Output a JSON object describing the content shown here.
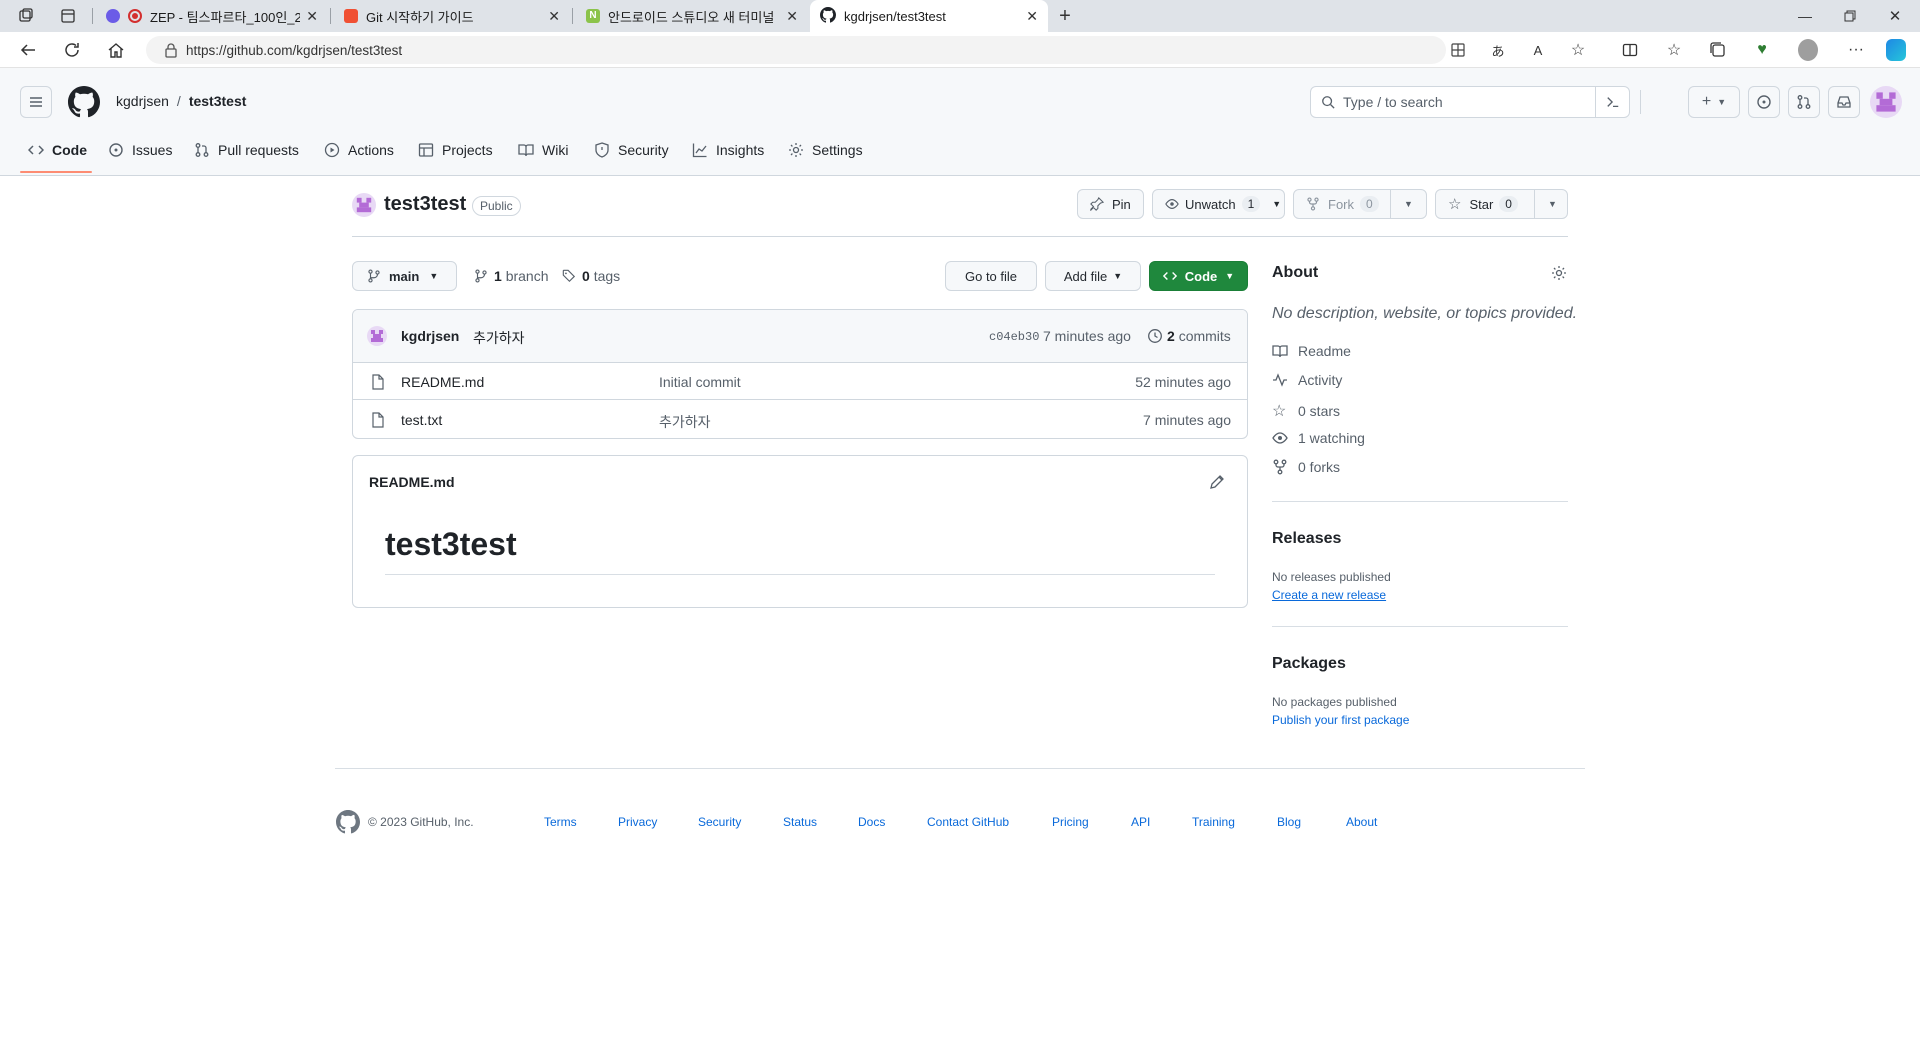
{
  "browser": {
    "tabs": [
      {
        "title": "ZEP - 팀스파르타_100인_2"
      },
      {
        "title": "Git 시작하기 가이드"
      },
      {
        "title": "안드로이드 스튜디오 새 터미널 열기"
      },
      {
        "title": "kgdrjsen/test3test"
      }
    ],
    "url": "https://github.com/kgdrjsen/test3test"
  },
  "header": {
    "owner": "kgdrjsen",
    "separator": "/",
    "repo": "test3test",
    "search_placeholder": "Type / to search"
  },
  "nav": {
    "items": [
      "Code",
      "Issues",
      "Pull requests",
      "Actions",
      "Projects",
      "Wiki",
      "Security",
      "Insights",
      "Settings"
    ],
    "active": "Code"
  },
  "repo": {
    "name": "test3test",
    "visibility": "Public",
    "pin": "Pin",
    "unwatch": "Unwatch",
    "watch_count": "1",
    "fork": "Fork",
    "fork_count": "0",
    "star": "Star",
    "star_count": "0",
    "branch": "main",
    "branch_count": "1",
    "branch_label": "branch",
    "tag_count": "0",
    "tag_label": "tags",
    "go_to_file": "Go to file",
    "add_file": "Add file",
    "code": "Code"
  },
  "commit": {
    "author": "kgdrjsen",
    "message": "추가하자",
    "hash": "c04eb30",
    "time": "7 minutes ago",
    "commit_count": "2",
    "commit_label": "commits"
  },
  "files": [
    {
      "name": "README.md",
      "message": "Initial commit",
      "time": "52 minutes ago"
    },
    {
      "name": "test.txt",
      "message": "추가하자",
      "time": "7 minutes ago"
    }
  ],
  "readme": {
    "filename": "README.md",
    "heading": "test3test"
  },
  "about": {
    "title": "About",
    "description": "No description, website, or topics provided.",
    "readme": "Readme",
    "activity": "Activity",
    "stars": "0 stars",
    "watching": "1 watching",
    "forks": "0 forks"
  },
  "releases": {
    "title": "Releases",
    "empty": "No releases published",
    "create": "Create a new release"
  },
  "packages": {
    "title": "Packages",
    "empty": "No packages published",
    "publish": "Publish your first package"
  },
  "footer": {
    "copyright": "© 2023 GitHub, Inc.",
    "links": [
      "Terms",
      "Privacy",
      "Security",
      "Status",
      "Docs",
      "Contact GitHub",
      "Pricing",
      "API",
      "Training",
      "Blog",
      "About"
    ]
  },
  "colors": {
    "accent": "#fd8c73",
    "primary_button": "#1f883d",
    "link": "#0969da"
  }
}
